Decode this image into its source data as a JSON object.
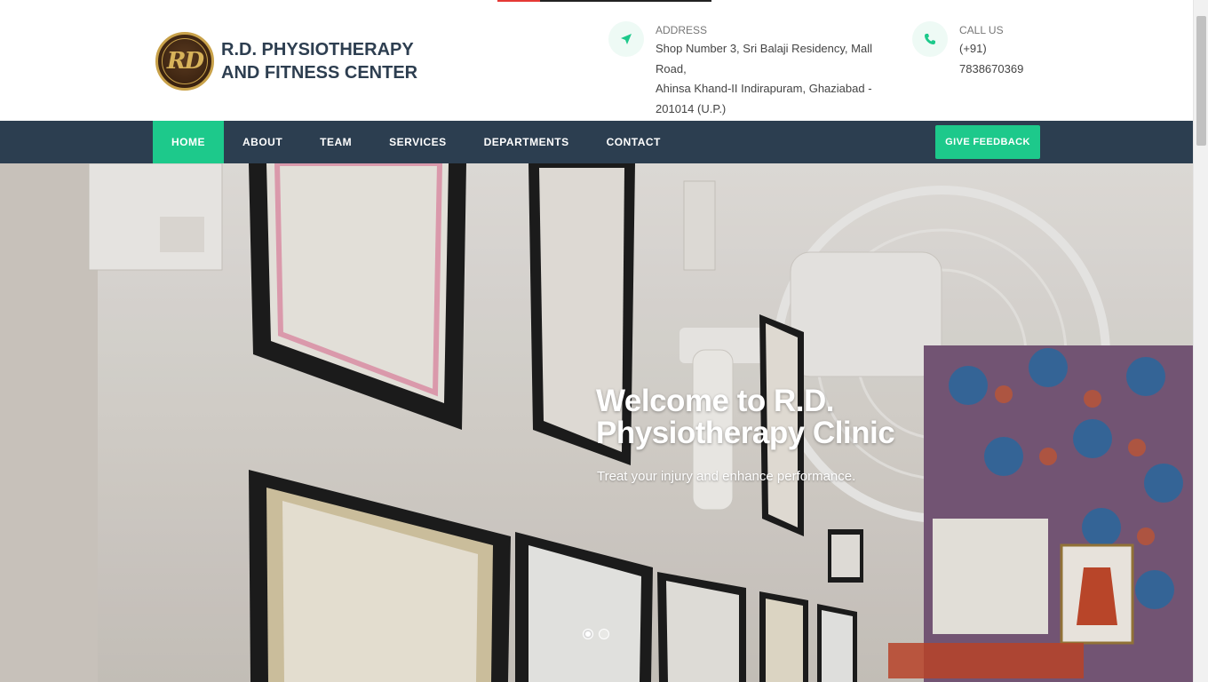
{
  "brand": {
    "name_line1": "R.D. PHYSIOTHERAPY",
    "name_line2": "AND FITNESS CENTER",
    "logo_monogram": "RD"
  },
  "contact": {
    "address": {
      "label": "ADDRESS",
      "icon": "location-arrow-icon",
      "line1": "Shop Number 3, Sri Balaji Residency, Mall Road,",
      "line2": "Ahinsa Khand-II Indirapuram, Ghaziabad -",
      "line3": "201014 (U.P.)"
    },
    "phone": {
      "label": "CALL US",
      "icon": "phone-icon",
      "line1": "(+91)",
      "line2": "7838670369"
    }
  },
  "nav": {
    "items": [
      {
        "label": "HOME",
        "active": true
      },
      {
        "label": "ABOUT"
      },
      {
        "label": "TEAM"
      },
      {
        "label": "SERVICES"
      },
      {
        "label": "DEPARTMENTS"
      },
      {
        "label": "CONTACT"
      }
    ],
    "feedback_label": "GIVE FEEDBACK"
  },
  "hero": {
    "title_line1": "Welcome to R.D.",
    "title_line2": "Physiotherapy Clinic",
    "subtitle": "Treat your injury and enhance performance.",
    "slide_count": 2,
    "active_slide": 1
  },
  "colors": {
    "accent": "#1dc98b",
    "nav_bg": "#2c3e50",
    "brand_text": "#2d3e50"
  }
}
